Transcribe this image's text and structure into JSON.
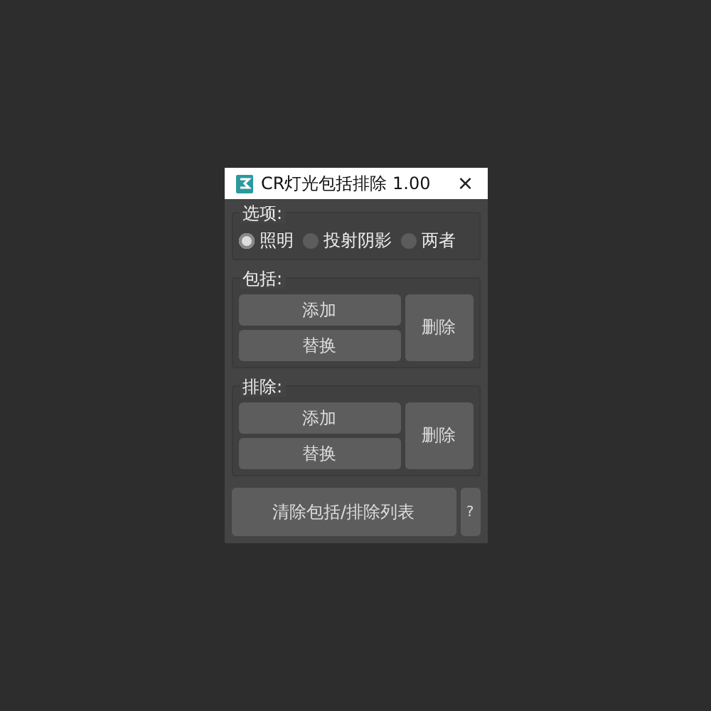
{
  "window": {
    "title": "CR灯光包括排除 1.00",
    "close": "×"
  },
  "options": {
    "label": "选项:",
    "radios": [
      {
        "label": "照明",
        "selected": true
      },
      {
        "label": "投射阴影",
        "selected": false
      },
      {
        "label": "两者",
        "selected": false
      }
    ]
  },
  "groups": [
    {
      "label": "包括:",
      "add": "添加",
      "replace": "替换",
      "remove": "删除"
    },
    {
      "label": "排除:",
      "add": "添加",
      "replace": "替换",
      "remove": "删除"
    }
  ],
  "clear_button": "清除包括/排除列表",
  "help_button": "?"
}
